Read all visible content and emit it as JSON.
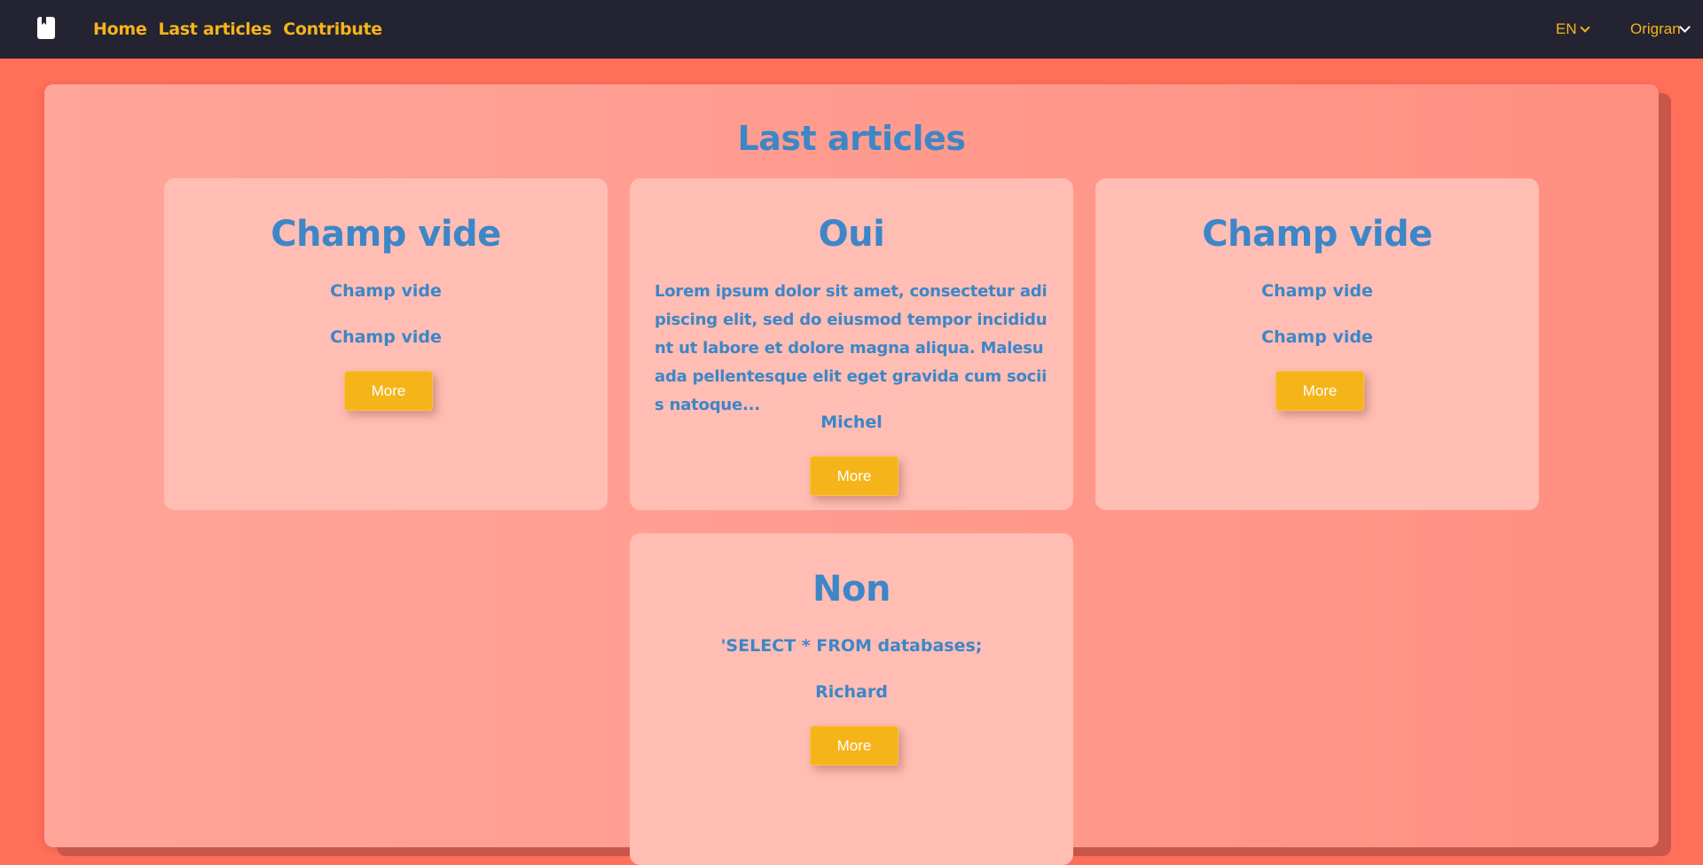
{
  "navbar": {
    "links": [
      "Home",
      "Last articles",
      "Contribute"
    ],
    "lang": "EN",
    "user": "Origran"
  },
  "page": {
    "title": "Last articles"
  },
  "cards": [
    {
      "title": "Champ vide",
      "line1": "Champ vide",
      "line2": "Champ vide",
      "button": "More"
    },
    {
      "title": "Oui",
      "text": "Lorem ipsum dolor sit amet, consectetur adipiscing elit, sed do eiusmod tempor incididunt ut labore et dolore magna aliqua. Malesuada pellentesque elit eget gravida cum sociis natoque...",
      "author": "Michel",
      "button": "More"
    },
    {
      "title": "Champ vide",
      "line1": "Champ vide",
      "line2": "Champ vide",
      "button": "More"
    },
    {
      "title": "Non",
      "line1": "'SELECT * FROM databases;",
      "author": "Richard",
      "button": "More"
    }
  ],
  "colors": {
    "navbar": "#232332",
    "accent": "#f5b41a",
    "title": "#3d86c8",
    "background": "#ff6f5a",
    "card": "#ffbdb3"
  },
  "icons": {
    "logo": "book-icon",
    "lang_dropdown": "chevron-down-icon",
    "user_dropdown": "chevron-down-icon"
  }
}
